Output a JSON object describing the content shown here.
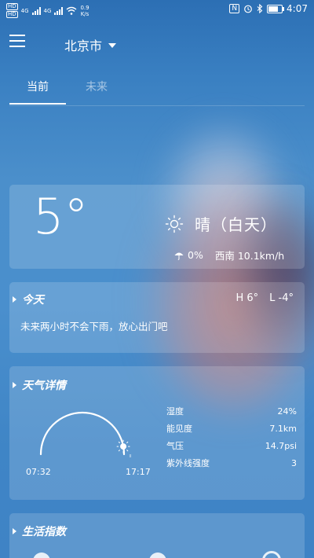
{
  "status_bar": {
    "hd1": "HD",
    "hd2": "HD",
    "net1": "4G",
    "net2": "4G",
    "speed_value": "0.9",
    "speed_unit": "K/s",
    "nfc": "N",
    "time": "4:07"
  },
  "header": {
    "city": "北京市"
  },
  "tabs": [
    {
      "label": "当前"
    },
    {
      "label": "未来"
    }
  ],
  "current": {
    "temperature": "5°",
    "condition": "晴（白天）",
    "precip": "0%",
    "wind": "西南 10.1km/h"
  },
  "today": {
    "title": "今天",
    "high": "H 6°",
    "low": "L -4°",
    "description": "未来两小时不会下雨，放心出门吧"
  },
  "details": {
    "title": "天气详情",
    "sunrise": "07:32",
    "sunset": "17:17",
    "sun_progress": 0.94,
    "rows": [
      {
        "label": "湿度",
        "value": "24%"
      },
      {
        "label": "能见度",
        "value": "7.1km"
      },
      {
        "label": "气压",
        "value": "14.7psi"
      },
      {
        "label": "紫外线强度",
        "value": "3"
      }
    ]
  },
  "life": {
    "title": "生活指数"
  },
  "colors": {
    "background_top": "#2c6fb4",
    "background_bottom": "#3f83c5",
    "card": "rgba(255,255,255,0.16)",
    "text": "#ffffff"
  },
  "icons": {
    "menu": "menu-icon",
    "dropdown": "caret-down-icon",
    "condition": "sun-icon",
    "precip": "umbrella-icon",
    "section": "triangle-right-icon"
  }
}
